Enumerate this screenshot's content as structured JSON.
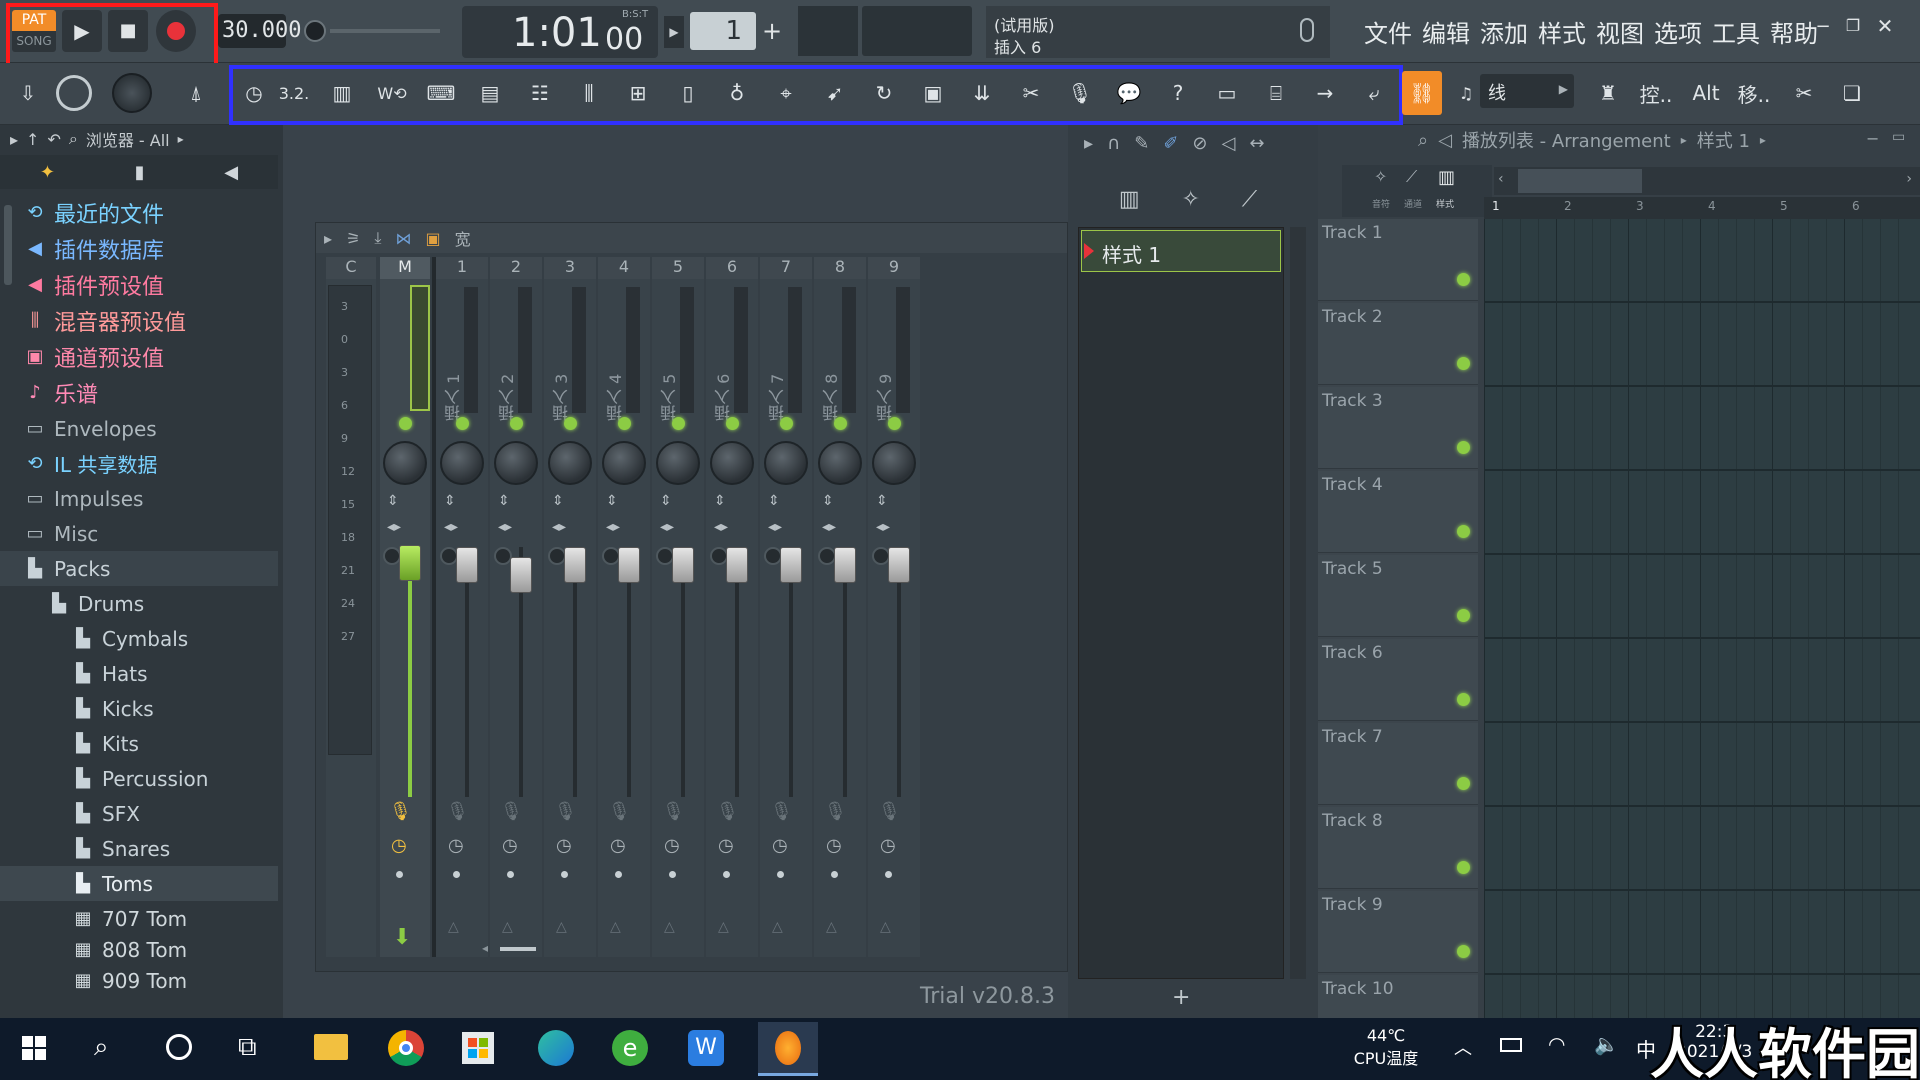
{
  "transport": {
    "mode_pat": "PAT",
    "mode_song": "SONG",
    "tempo": "30.000",
    "time": "1:01",
    "time_small": "00",
    "time_label": "B:S:T",
    "pattern_num": "1"
  },
  "hint": {
    "line1": "(试用版)",
    "line2": "插入 6"
  },
  "menu": [
    "文件",
    "编辑",
    "添加",
    "样式",
    "视图",
    "选项",
    "工具",
    "帮助"
  ],
  "toolbar": {
    "snap": "线",
    "ctrl_label": "控..",
    "alt_label": "Alt",
    "move_label": "移.."
  },
  "browser": {
    "title": "浏览器 - All",
    "items": [
      {
        "label": "最近的文件",
        "icon": "recent-files-icon",
        "color": "#7ad2ff"
      },
      {
        "label": "插件数据库",
        "icon": "plugin-db-icon",
        "color": "#7ab8ff"
      },
      {
        "label": "插件预设值",
        "icon": "plugin-preset-icon",
        "color": "#ff7aa0"
      },
      {
        "label": "混音器预设值",
        "icon": "mixer-preset-icon",
        "color": "#ff9a9a"
      },
      {
        "label": "通道预设值",
        "icon": "channel-preset-icon",
        "color": "#ff88aa"
      },
      {
        "label": "乐谱",
        "icon": "score-icon",
        "color": "#ff8ab6"
      },
      {
        "label": "Envelopes",
        "icon": "folder-icon",
        "color": "#aeb8be"
      },
      {
        "label": "IL 共享数据",
        "icon": "shared-data-icon",
        "color": "#7ad2ff"
      },
      {
        "label": "Impulses",
        "icon": "folder-icon",
        "color": "#aeb8be"
      },
      {
        "label": "Misc",
        "icon": "folder-icon",
        "color": "#aeb8be"
      },
      {
        "label": "Packs",
        "icon": "packs-icon",
        "color": "#c8d2d8"
      },
      {
        "label": "Drums",
        "icon": "packs-icon",
        "color": "#c8d2d8"
      },
      {
        "label": "Cymbals",
        "icon": "packs-icon",
        "color": "#c8d2d8"
      },
      {
        "label": "Hats",
        "icon": "packs-icon",
        "color": "#c8d2d8"
      },
      {
        "label": "Kicks",
        "icon": "packs-icon",
        "color": "#c8d2d8"
      },
      {
        "label": "Kits",
        "icon": "packs-icon",
        "color": "#c8d2d8"
      },
      {
        "label": "Percussion",
        "icon": "packs-icon",
        "color": "#c8d2d8"
      },
      {
        "label": "SFX",
        "icon": "packs-icon",
        "color": "#c8d2d8"
      },
      {
        "label": "Snares",
        "icon": "packs-icon",
        "color": "#c8d2d8"
      },
      {
        "label": "Toms",
        "icon": "packs-icon",
        "color": "#e8eef2"
      },
      {
        "label": "707 Tom",
        "icon": "sample-icon",
        "color": "#d0d8dc"
      },
      {
        "label": "808 Tom",
        "icon": "sample-icon",
        "color": "#d0d8dc"
      },
      {
        "label": "909 Tom",
        "icon": "sample-icon",
        "color": "#d0d8dc"
      }
    ]
  },
  "mixer": {
    "header_label": "宽",
    "columns": [
      "C",
      "M",
      "1",
      "2",
      "3",
      "4",
      "5",
      "6",
      "7",
      "8",
      "9"
    ],
    "inserts": [
      "插入 1",
      "插入 2",
      "插入 3",
      "插入 4",
      "插入 5",
      "插入 6",
      "插入 7",
      "插入 8",
      "插入 9"
    ],
    "meter_scale": [
      "3",
      "0",
      "3",
      "6",
      "9",
      "12",
      "15",
      "18",
      "21",
      "24",
      "27"
    ]
  },
  "pattern": {
    "name": "样式 1"
  },
  "playlist": {
    "title": "播放列表 - Arrangement",
    "pattern": "样式 1",
    "tool_labels": [
      "音符",
      "通道",
      "样式"
    ],
    "ruler": [
      "1",
      "2",
      "3",
      "4",
      "5",
      "6"
    ],
    "tracks": [
      "Track 1",
      "Track 2",
      "Track 3",
      "Track 4",
      "Track 5",
      "Track 6",
      "Track 7",
      "Track 8",
      "Track 9",
      "Track 10"
    ]
  },
  "trial": "Trial v20.8.3",
  "taskbar": {
    "temp": "44℃",
    "temp_label": "CPU温度",
    "time": "22:3",
    "date": "2021/5/3",
    "watermark": "人人软件园",
    "ime": "中"
  }
}
